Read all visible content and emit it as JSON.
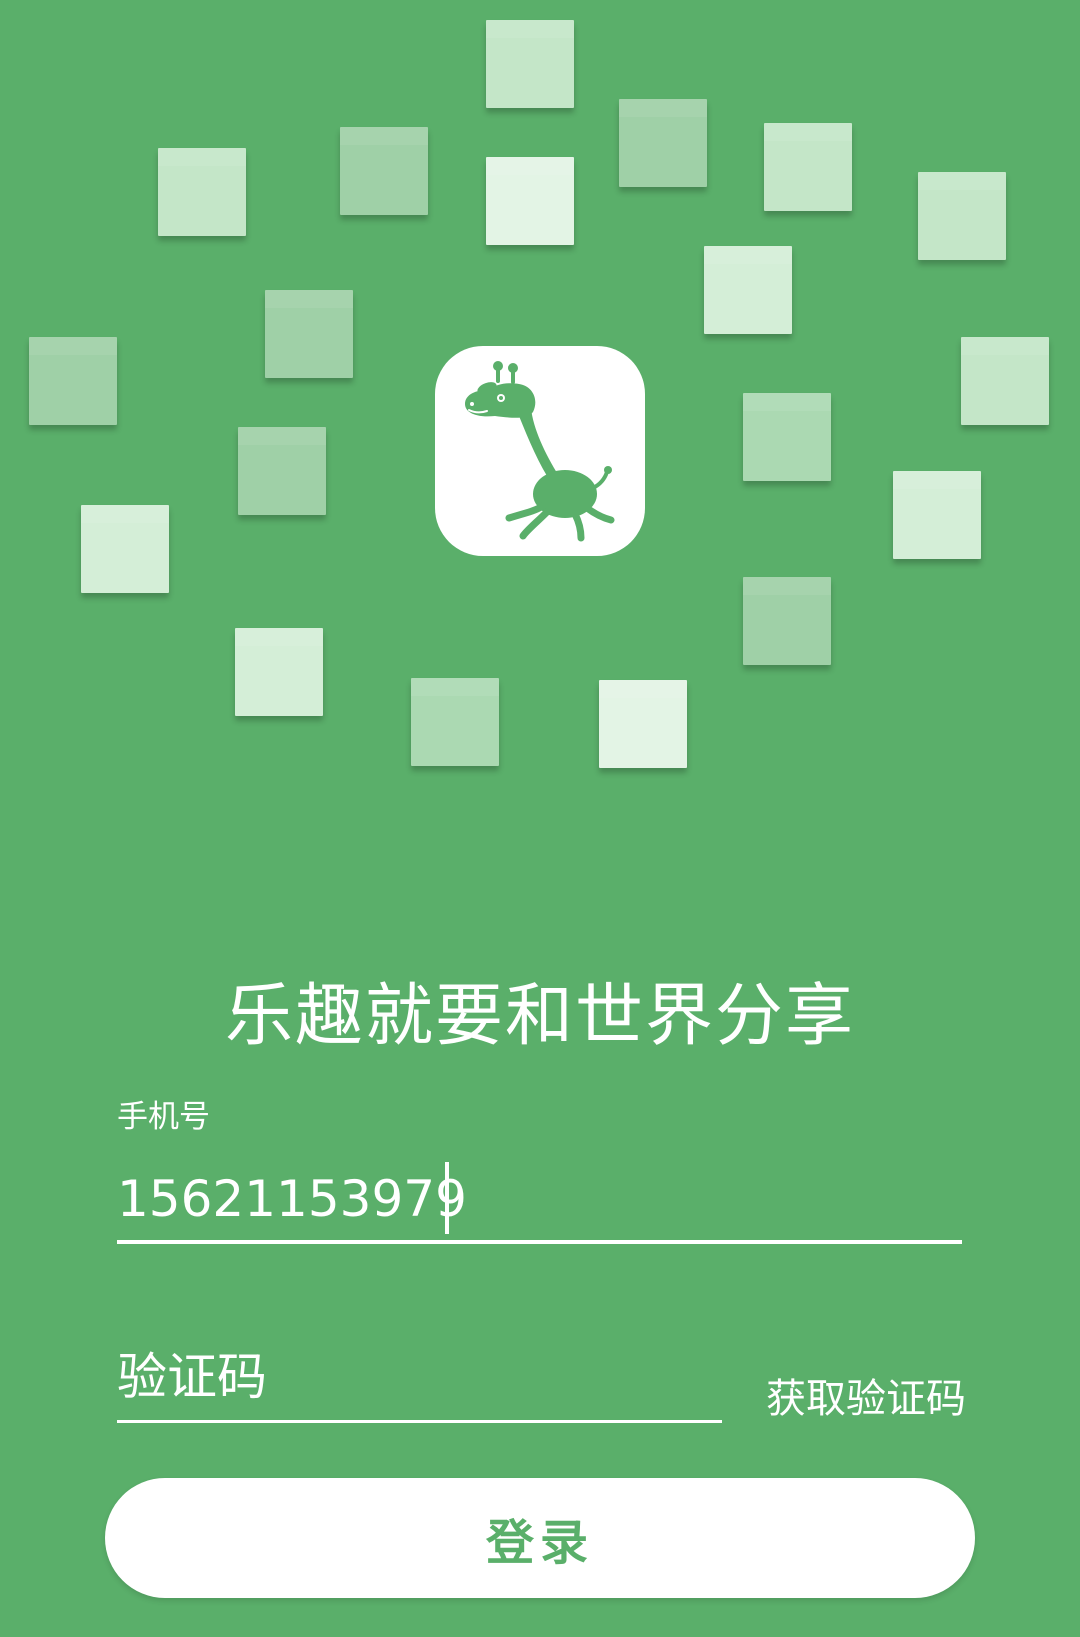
{
  "app": {
    "logo_icon": "giraffe-icon",
    "colors": {
      "background": "#5aaf6a",
      "accent": "#ffffff",
      "button_text": "#5aaf6a"
    }
  },
  "slogan": "乐趣就要和世界分享",
  "phone": {
    "label": "手机号",
    "value": "15621153979"
  },
  "code": {
    "placeholder": "验证码",
    "get_code_label": "获取验证码"
  },
  "login": {
    "label": "登录"
  }
}
